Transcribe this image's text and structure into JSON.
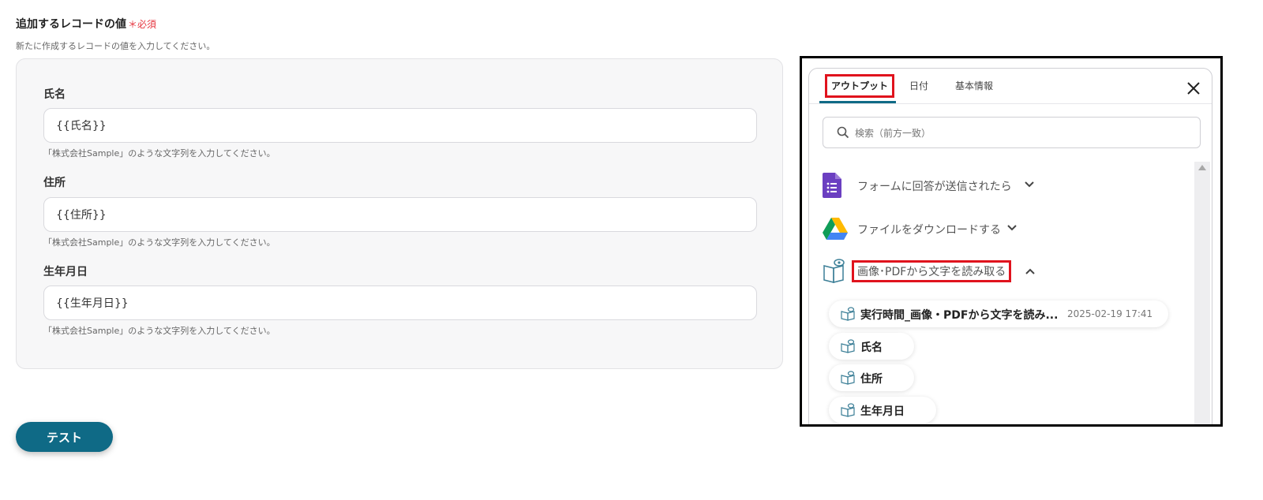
{
  "section": {
    "title": "追加するレコードの値",
    "required": "＊必須",
    "description": "新たに作成するレコードの値を入力してください。"
  },
  "fields": [
    {
      "label": "氏名",
      "value": "{{氏名}}",
      "help": "「株式会社Sample」のような文字列を入力してください。"
    },
    {
      "label": "住所",
      "value": "{{住所}}",
      "help": "「株式会社Sample」のような文字列を入力してください。"
    },
    {
      "label": "生年月日",
      "value": "{{生年月日}}",
      "help": "「株式会社Sample」のような文字列を入力してください。"
    }
  ],
  "test_button": "テスト",
  "panel": {
    "tabs": [
      "アウトプット",
      "日付",
      "基本情報"
    ],
    "active_tab": "アウトプット",
    "search_placeholder": "検索（前方一致）",
    "groups": [
      {
        "label": "フォームに回答が送信されたら",
        "icon": "google-forms-icon",
        "state": "collapsed"
      },
      {
        "label": "ファイルをダウンロードする",
        "icon": "google-drive-icon",
        "state": "collapsed"
      },
      {
        "label": "画像･PDFから文字を読み取る",
        "icon": "ocr-book-icon",
        "state": "expanded"
      }
    ],
    "items": [
      {
        "label": "実行時間_画像・PDFから文字を読み...",
        "date": "2025-02-19 17:41"
      },
      {
        "label": "氏名"
      },
      {
        "label": "住所"
      },
      {
        "label": "生年月日"
      }
    ]
  },
  "colors": {
    "accent": "#0f6a86",
    "required": "#e5353f",
    "highlight": "#e0131d"
  }
}
